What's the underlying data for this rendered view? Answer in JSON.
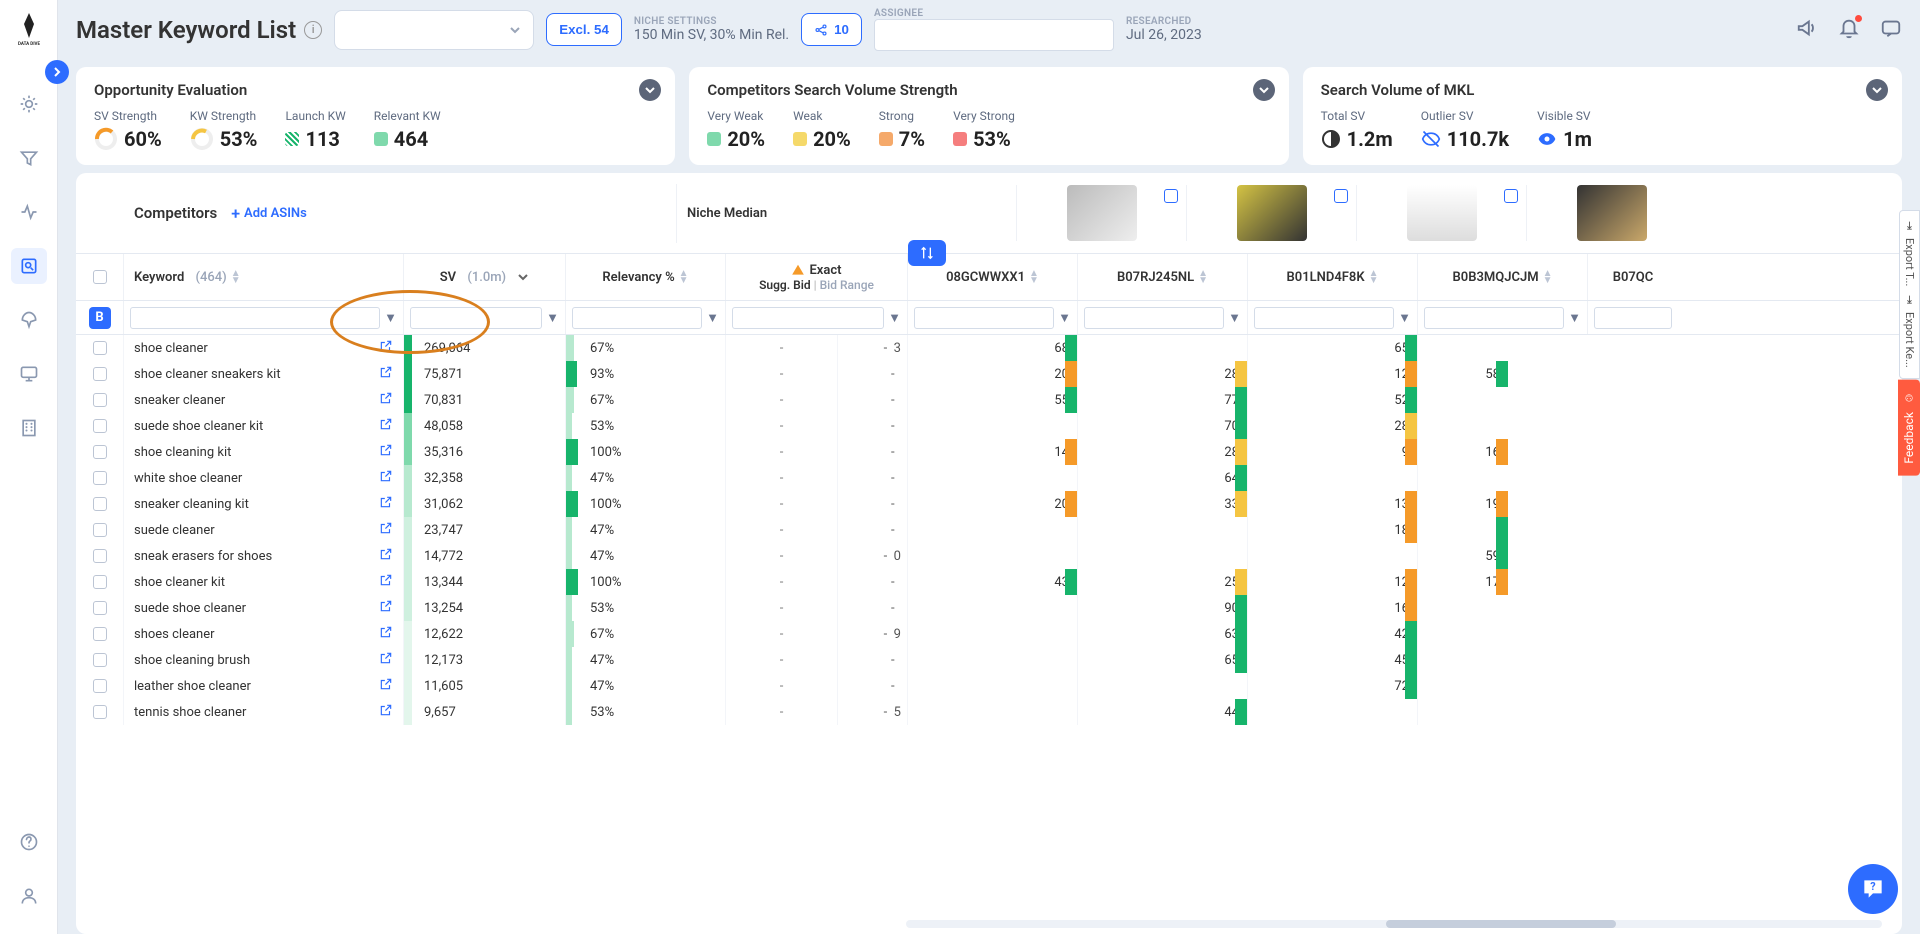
{
  "sidebar": {
    "items": [
      "insights",
      "filter",
      "activity",
      "research",
      "launch",
      "desktop",
      "office"
    ],
    "bottom": [
      "help",
      "account"
    ]
  },
  "header": {
    "title": "Master Keyword List",
    "excl_btn": "Excl. 54",
    "niche_label": "NICHE SETTINGS",
    "niche_value": "150 Min SV, 30% Min Rel.",
    "share_count": "10",
    "assignee_label": "ASSIGNEE",
    "researched_label": "RESEARCHED",
    "researched_value": "Jul 26, 2023"
  },
  "cards": {
    "opp": {
      "title": "Opportunity Evaluation",
      "sv_strength_label": "SV Strength",
      "sv_strength_val": "60%",
      "kw_strength_label": "KW Strength",
      "kw_strength_val": "53%",
      "launch_kw_label": "Launch KW",
      "launch_kw_val": "113",
      "relevant_kw_label": "Relevant KW",
      "relevant_kw_val": "464"
    },
    "comp": {
      "title": "Competitors Search Volume Strength",
      "very_weak_label": "Very Weak",
      "very_weak_val": "20%",
      "weak_label": "Weak",
      "weak_val": "20%",
      "strong_label": "Strong",
      "strong_val": "7%",
      "very_strong_label": "Very Strong",
      "very_strong_val": "53%"
    },
    "mkl": {
      "title": "Search Volume of MKL",
      "total_label": "Total SV",
      "total_val": "1.2m",
      "outlier_label": "Outlier SV",
      "outlier_val": "110.7k",
      "visible_label": "Visible SV",
      "visible_val": "1m"
    }
  },
  "competitors_bar": {
    "title": "Competitors",
    "add_asin": "Add ASINs",
    "niche_median": "Niche Median"
  },
  "columns": {
    "keyword": "Keyword",
    "keyword_count": "(464)",
    "sv": "SV",
    "sv_meta": "(1.0m)",
    "relevancy": "Relevancy %",
    "exact": "Exact",
    "sugg_bid": "Sugg. Bid",
    "bid_range": "Bid Range",
    "asin1": "08GCWWXX1",
    "asin2": "B07RJ245NL",
    "asin3": "B01LND4F8K",
    "asin4": "B0B3MQJCJM",
    "asin5": "B07QC"
  },
  "brand_badge": "B",
  "rows": [
    {
      "kw": "shoe cleaner",
      "sv": "269,064",
      "sv_bar": "#17b46b",
      "rel": "67%",
      "rel_w": 67,
      "bid": "-",
      "range": "-",
      "a1": "3",
      "a1c": "",
      "a2": "68",
      "a2c": "#17b46b",
      "a3": "",
      "a3c": "",
      "a4": "65",
      "a4c": "#17b46b",
      "a5": "",
      "a5c": ""
    },
    {
      "kw": "shoe cleaner sneakers kit",
      "sv": "75,871",
      "sv_bar": "#17b46b",
      "rel": "93%",
      "rel_w": 93,
      "bid": "-",
      "range": "-",
      "a1": "",
      "a1c": "",
      "a2": "20",
      "a2c": "#f59a29",
      "a3": "28",
      "a3c": "#f5c542",
      "a4": "12",
      "a4c": "#f59a29",
      "a5": "58",
      "a5c": "#17b46b"
    },
    {
      "kw": "sneaker cleaner",
      "sv": "70,831",
      "sv_bar": "#17b46b",
      "rel": "67%",
      "rel_w": 67,
      "bid": "-",
      "range": "-",
      "a1": "",
      "a1c": "",
      "a2": "55",
      "a2c": "#17b46b",
      "a3": "77",
      "a3c": "#17b46b",
      "a4": "52",
      "a4c": "#17b46b",
      "a5": "",
      "a5c": ""
    },
    {
      "kw": "suede shoe cleaner kit",
      "sv": "48,058",
      "sv_bar": "#7fd9ac",
      "rel": "53%",
      "rel_w": 53,
      "bid": "-",
      "range": "-",
      "a1": "",
      "a1c": "",
      "a2": "",
      "a2c": "",
      "a3": "70",
      "a3c": "#17b46b",
      "a4": "28",
      "a4c": "#f5c542",
      "a5": "",
      "a5c": ""
    },
    {
      "kw": "shoe cleaning kit",
      "sv": "35,316",
      "sv_bar": "#7fd9ac",
      "rel": "100%",
      "rel_w": 100,
      "bid": "-",
      "range": "-",
      "a1": "",
      "a1c": "",
      "a2": "14",
      "a2c": "#f59a29",
      "a3": "28",
      "a3c": "#f5c542",
      "a4": "9",
      "a4c": "#f59a29",
      "a5": "16",
      "a5c": "#f59a29"
    },
    {
      "kw": "white shoe cleaner",
      "sv": "32,358",
      "sv_bar": "#b7e9cf",
      "rel": "47%",
      "rel_w": 47,
      "bid": "-",
      "range": "-",
      "a1": "",
      "a1c": "",
      "a2": "",
      "a2c": "",
      "a3": "64",
      "a3c": "#17b46b",
      "a4": "",
      "a4c": "",
      "a5": "",
      "a5c": ""
    },
    {
      "kw": "sneaker cleaning kit",
      "sv": "31,062",
      "sv_bar": "#b7e9cf",
      "rel": "100%",
      "rel_w": 100,
      "bid": "-",
      "range": "-",
      "a1": "",
      "a1c": "",
      "a2": "20",
      "a2c": "#f59a29",
      "a3": "33",
      "a3c": "#f5c542",
      "a4": "13",
      "a4c": "#f59a29",
      "a5": "19",
      "a5c": "#f59a29"
    },
    {
      "kw": "suede cleaner",
      "sv": "23,747",
      "sv_bar": "#cff0df",
      "rel": "47%",
      "rel_w": 47,
      "bid": "-",
      "range": "-",
      "a1": "",
      "a1c": "",
      "a2": "",
      "a2c": "",
      "a3": "",
      "a3c": "",
      "a4": "18",
      "a4c": "#f59a29",
      "a5": "",
      "a5c": "#17b46b"
    },
    {
      "kw": "sneak erasers for shoes",
      "sv": "14,772",
      "sv_bar": "#cff0df",
      "rel": "47%",
      "rel_w": 47,
      "bid": "-",
      "range": "-",
      "a1": "0",
      "a1c": "",
      "a2": "",
      "a2c": "",
      "a3": "",
      "a3c": "",
      "a4": "",
      "a4c": "",
      "a5": "59",
      "a5c": "#17b46b"
    },
    {
      "kw": "shoe cleaner kit",
      "sv": "13,344",
      "sv_bar": "#cff0df",
      "rel": "100%",
      "rel_w": 100,
      "bid": "-",
      "range": "-",
      "a1": "",
      "a1c": "",
      "a2": "43",
      "a2c": "#17b46b",
      "a3": "25",
      "a3c": "#f5c542",
      "a4": "12",
      "a4c": "#f59a29",
      "a5": "17",
      "a5c": "#f59a29"
    },
    {
      "kw": "suede shoe cleaner",
      "sv": "13,254",
      "sv_bar": "#cff0df",
      "rel": "53%",
      "rel_w": 53,
      "bid": "-",
      "range": "-",
      "a1": "",
      "a1c": "",
      "a2": "",
      "a2c": "",
      "a3": "90",
      "a3c": "#17b46b",
      "a4": "16",
      "a4c": "#f59a29",
      "a5": "",
      "a5c": ""
    },
    {
      "kw": "shoes cleaner",
      "sv": "12,622",
      "sv_bar": "#e3f6ec",
      "rel": "67%",
      "rel_w": 67,
      "bid": "-",
      "range": "-",
      "a1": "9",
      "a1c": "",
      "a2": "",
      "a2c": "",
      "a3": "63",
      "a3c": "#17b46b",
      "a4": "42",
      "a4c": "#17b46b",
      "a5": "",
      "a5c": ""
    },
    {
      "kw": "shoe cleaning brush",
      "sv": "12,173",
      "sv_bar": "#e3f6ec",
      "rel": "47%",
      "rel_w": 47,
      "bid": "-",
      "range": "-",
      "a1": "",
      "a1c": "",
      "a2": "",
      "a2c": "",
      "a3": "65",
      "a3c": "#17b46b",
      "a4": "45",
      "a4c": "#17b46b",
      "a5": "",
      "a5c": ""
    },
    {
      "kw": "leather shoe cleaner",
      "sv": "11,605",
      "sv_bar": "#e3f6ec",
      "rel": "47%",
      "rel_w": 47,
      "bid": "-",
      "range": "-",
      "a1": "",
      "a1c": "",
      "a2": "",
      "a2c": "",
      "a3": "",
      "a3c": "",
      "a4": "72",
      "a4c": "#17b46b",
      "a5": "",
      "a5c": ""
    },
    {
      "kw": "tennis shoe cleaner",
      "sv": "9,657",
      "sv_bar": "#e3f6ec",
      "rel": "53%",
      "rel_w": 53,
      "bid": "-",
      "range": "-",
      "a1": "5",
      "a1c": "",
      "a2": "",
      "a2c": "",
      "a3": "44",
      "a3c": "#17b46b",
      "a4": "",
      "a4c": "",
      "a5": "",
      "a5c": ""
    }
  ],
  "export_labels": {
    "export1": "Export T...",
    "export2": "Export Ke..."
  },
  "feedback": "Feedback"
}
